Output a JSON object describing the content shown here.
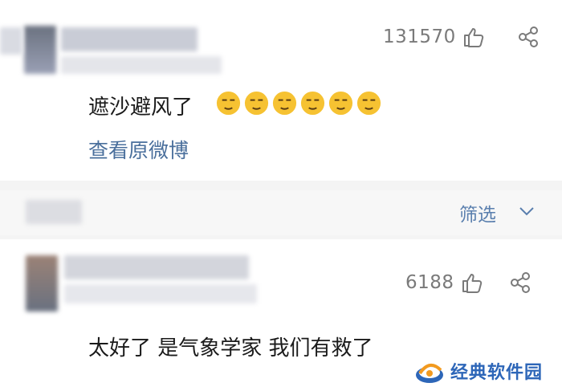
{
  "comments": [
    {
      "like_count": "131570",
      "text": "遮沙避风了",
      "emoji_icons": [
        "smirk-emoji-icon",
        "smirk-emoji-icon",
        "smirk-emoji-icon",
        "smirk-emoji-icon",
        "smirk-emoji-icon",
        "smirk-emoji-icon"
      ],
      "view_original_link": "查看原微博"
    },
    {
      "like_count": "6188",
      "text": "太好了 是气象学家 我们有救了"
    }
  ],
  "filter": {
    "label": "筛选"
  },
  "watermark": {
    "text": "经典软件园"
  },
  "colors": {
    "link": "#4a6f9c",
    "filter": "#5a7fae",
    "watermark": "#2d66b8",
    "emoji": "#f6c232"
  }
}
